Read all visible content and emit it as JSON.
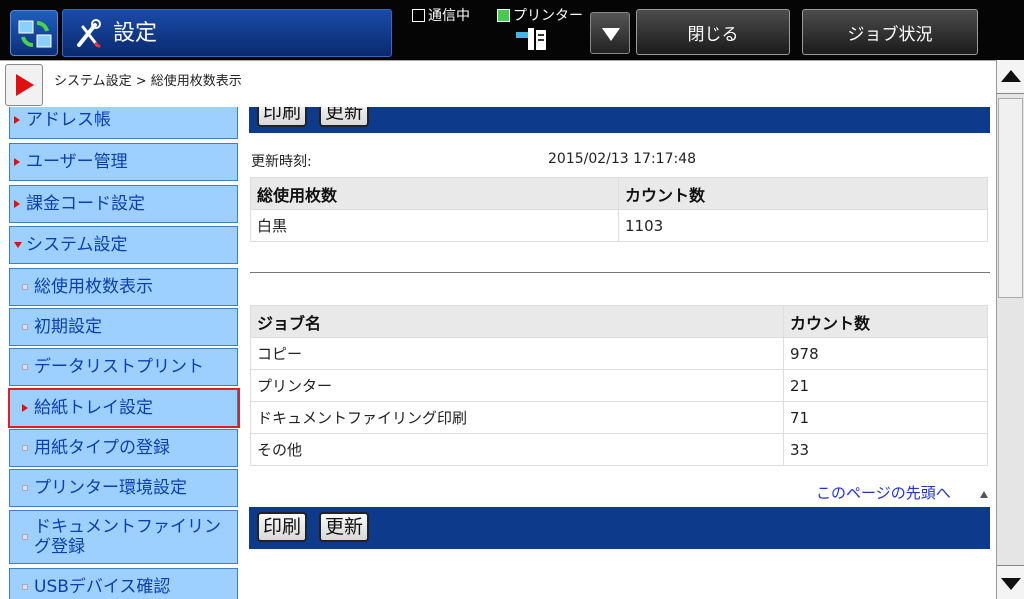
{
  "header": {
    "title": "設定",
    "status_comm": "通信中",
    "status_printer": "プリンター",
    "close_label": "閉じる",
    "job_status_label": "ジョブ状況"
  },
  "breadcrumb": "システム設定 > 総使用枚数表示",
  "sidebar": {
    "items": [
      {
        "label": "アドレス帳"
      },
      {
        "label": "ユーザー管理"
      },
      {
        "label": "課金コード設定"
      },
      {
        "label": "システム設定"
      },
      {
        "label": "総使用枚数表示"
      },
      {
        "label": "初期設定"
      },
      {
        "label": "データリストプリント"
      },
      {
        "label": "給紙トレイ設定"
      },
      {
        "label": "用紙タイプの登録"
      },
      {
        "label": "プリンター環境設定"
      },
      {
        "label": "ドキュメントファイリング登録"
      },
      {
        "label": "USBデバイス確認"
      }
    ]
  },
  "main": {
    "print_label": "印刷",
    "refresh_label": "更新",
    "updated_label": "更新時刻:",
    "updated_value": "2015/02/13 17:17:48",
    "total_table": {
      "headers": [
        "総使用枚数",
        "カウント数"
      ],
      "rows": [
        [
          "白黒",
          "1103"
        ]
      ]
    },
    "job_table": {
      "headers": [
        "ジョブ名",
        "カウント数"
      ],
      "rows": [
        [
          "コピー",
          "978"
        ],
        [
          "プリンター",
          "21"
        ],
        [
          "ドキュメントファイリング印刷",
          "71"
        ],
        [
          "その他",
          "33"
        ]
      ]
    },
    "top_link": "このページの先頭へ"
  },
  "colors": {
    "accent_blue": "#0d3a8a",
    "sidebar_bg": "#9dd0ff",
    "highlight": "#e02020"
  }
}
